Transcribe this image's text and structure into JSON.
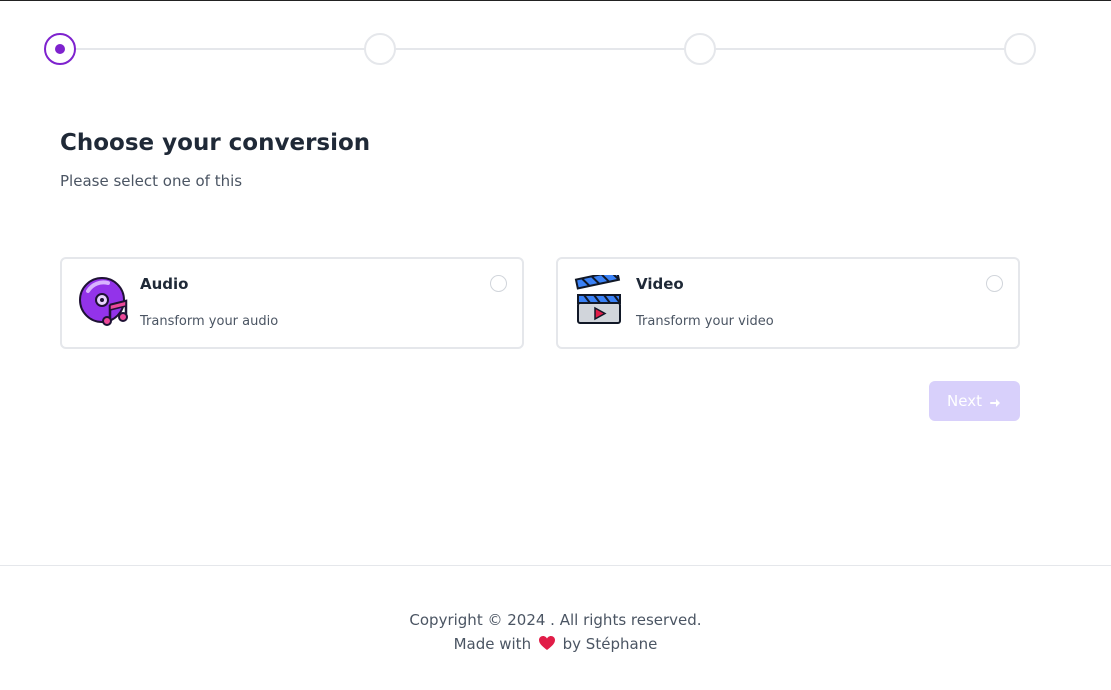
{
  "stepper": {
    "steps": [
      {
        "state": "active"
      },
      {
        "state": "inactive"
      },
      {
        "state": "inactive"
      },
      {
        "state": "inactive"
      }
    ]
  },
  "page": {
    "title": "Choose your conversion",
    "subtitle": "Please select one of this"
  },
  "options": [
    {
      "title": "Audio",
      "description": "Transform your audio",
      "icon": "audio-disc-icon"
    },
    {
      "title": "Video",
      "description": "Transform your video",
      "icon": "clapperboard-icon"
    }
  ],
  "actions": {
    "next_label": "Next",
    "next_icon": "arrow-right-icon"
  },
  "footer": {
    "copyright": "Copyright © 2024 . All rights reserved.",
    "made_with": "Made with",
    "heart_icon": "heart-icon",
    "by": "by Stéphane"
  },
  "colors": {
    "accent": "#7e22ce",
    "next_disabled_bg": "#d8d0fb",
    "border": "#e5e7eb",
    "heart": "#e11d48"
  }
}
